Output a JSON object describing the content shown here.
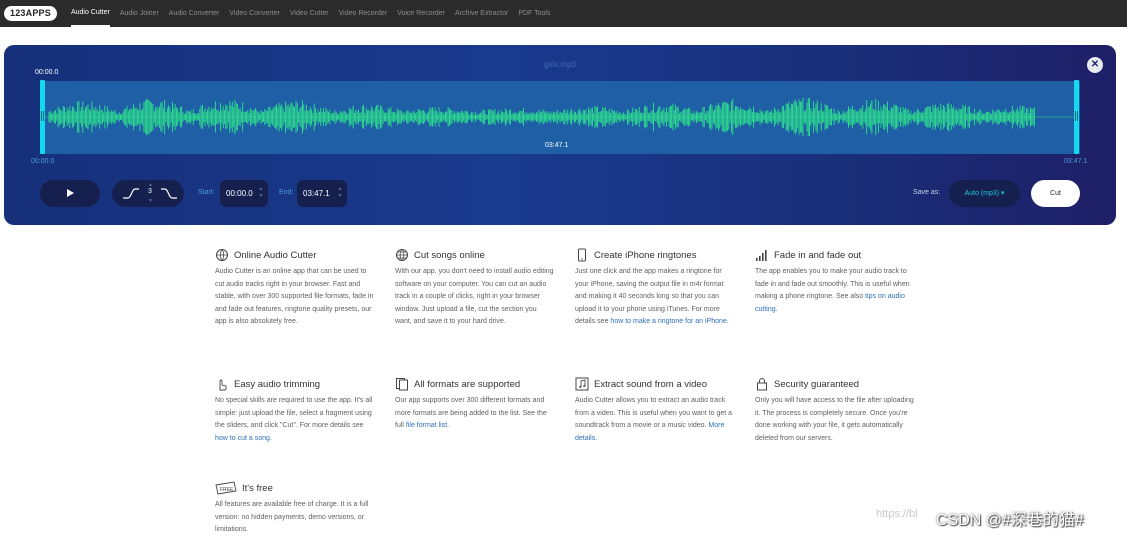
{
  "nav": {
    "logo": "123APPS",
    "items": [
      {
        "label": "Audio Cutter",
        "active": true
      },
      {
        "label": "Audio Joiner"
      },
      {
        "label": "Audio Converter"
      },
      {
        "label": "Video Converter"
      },
      {
        "label": "Video Cutter"
      },
      {
        "label": "Video Recorder"
      },
      {
        "label": "Voice Recorder"
      },
      {
        "label": "Archive Extractor"
      },
      {
        "label": "PDF Tools"
      }
    ]
  },
  "editor": {
    "filename": "gsls.mp3",
    "close_icon": "close-icon",
    "current_time": "00:00.0",
    "duration_mid": "03:47.1",
    "range_start": "00:00.0",
    "range_end": "03:47.1",
    "play_icon": "play-icon",
    "fade_in_icon": "fade-in-icon",
    "fade_out_icon": "fade-out-icon",
    "fade_value": "3",
    "start_label": "Start:",
    "start_value": "00:00.0",
    "end_label": "End:",
    "end_value": "03:47.1",
    "save_as_label": "Save as:",
    "format_label": "Auto (mp3)",
    "cut_label": "Cut",
    "colors": {
      "accent": "#16d8ee",
      "waveform": "#2ee58c",
      "panel": "#1a3a8e"
    }
  },
  "features": [
    {
      "icon": "globe-hand-icon",
      "title": "Online Audio Cutter",
      "desc": "Audio Cutter is an online app that can be used to cut audio tracks right in your browser. Fast and stable, with over 300 supported file formats, fade in and fade out features, ringtone quality presets, our app is also absolutely free."
    },
    {
      "icon": "globe-icon",
      "title": "Cut songs online",
      "desc": "With our app, you don't need to install audio editing software on your computer. You can cut an audio track in a couple of clicks, right in your browser window. Just upload a file, cut the section you want, and save it to your hard drive."
    },
    {
      "icon": "phone-icon",
      "title": "Create iPhone ringtones",
      "desc": "Just one click and the app makes a ringtone for your iPhone, saving the output file in m4r format and making it 40 seconds long so that you can upload it to your phone using iTunes. For more details see ",
      "link": "how to make a ringtone for an iPhone",
      "after": "."
    },
    {
      "icon": "signal-bars-icon",
      "title": "Fade in and fade out",
      "desc": "The app enables you to make your audio track to fade in and fade out smoothly. This is useful when making a phone ringtone. See also ",
      "link": "tips on audio cutting",
      "after": "."
    },
    {
      "icon": "pointer-hand-icon",
      "title": "Easy audio trimming",
      "desc": "No special skills are required to use the app. It's all simple: just upload the file, select a fragment using the sliders, and click \"Cut\". For more details see ",
      "link": "how to cut a song",
      "after": "."
    },
    {
      "icon": "files-icon",
      "title": "All formats are supported",
      "desc": "Our app supports over 300 different formats and more formats are being added to the list. See the full ",
      "link": "file format list",
      "after": "."
    },
    {
      "icon": "music-note-icon",
      "title": "Extract sound from a video",
      "desc": "Audio Cutter allows you to extract an audio track from a video. This is useful when you want to get a soundtrack from a movie or a music video. ",
      "link": "More details",
      "after": "."
    },
    {
      "icon": "lock-icon",
      "title": "Security guaranteed",
      "desc": "Only you will have access to the file after uploading it. The process is completely secure. Once you're done working with your file, it gets automatically deleted from our servers."
    },
    {
      "icon": "free-tag-icon",
      "title": "It's free",
      "desc": "All features are available free of charge. It is a full version: no hidden payments, demo versions, or limitations."
    }
  ],
  "watermark": "https://bl",
  "watermark2": "CSDN @#深巷的猫#"
}
